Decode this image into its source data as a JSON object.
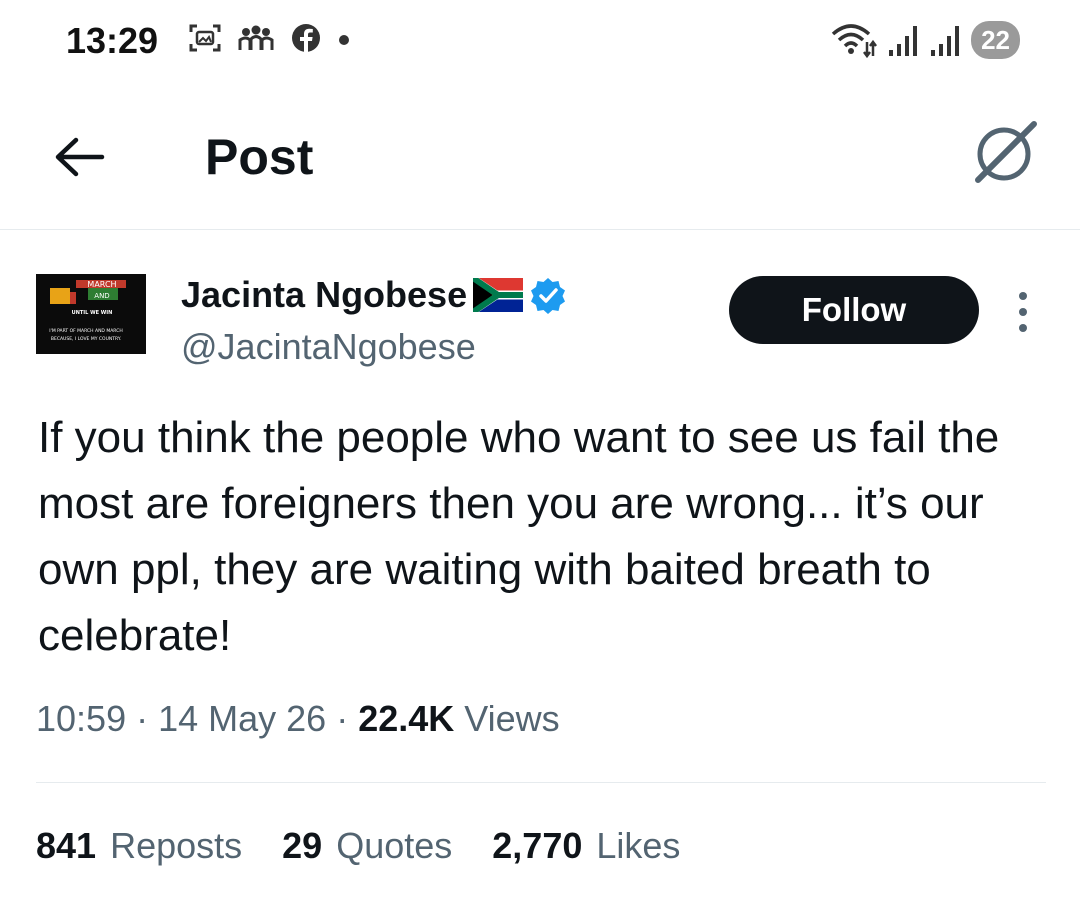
{
  "status_bar": {
    "time": "13:29",
    "left_icons": [
      "screenshot-icon",
      "group-icon",
      "facebook-icon",
      "dot-icon"
    ],
    "right_icons": [
      "wifi-icon",
      "signal-icon",
      "signal-icon"
    ],
    "battery": "22"
  },
  "header": {
    "title": "Post",
    "back_icon": "arrow-left-icon",
    "grok_icon": "grok-icon"
  },
  "author": {
    "display_name": "Jacinta Ngobese",
    "flag": "🇿🇦",
    "verified_icon": "verified-badge-icon",
    "handle": "@JacintaNgobese",
    "follow_label": "Follow",
    "avatar": {
      "line1": "MARCH",
      "line2": "AND",
      "line3": "UNTIL WE WIN",
      "line4": "I'M PART OF MARCH AND MARCH",
      "line5": "BECAUSE, I LOVE MY COUNTRY."
    }
  },
  "post": {
    "text": "If you think the people who want to see us fail the most are foreigners then you are wrong... it’s our own ppl, they are  waiting with baited breath to celebrate!",
    "time": "10:59",
    "date": "14 May 26",
    "views_count": "22.4K",
    "views_label": "Views",
    "separator": " · "
  },
  "stats": {
    "reposts_count": "841",
    "reposts_label": "Reposts",
    "quotes_count": "29",
    "quotes_label": "Quotes",
    "likes_count": "2,770",
    "likes_label": "Likes"
  },
  "colors": {
    "text_primary": "#0f1419",
    "text_secondary": "#536471",
    "verified_blue": "#1d9bf0",
    "divider": "#e6ebee"
  }
}
